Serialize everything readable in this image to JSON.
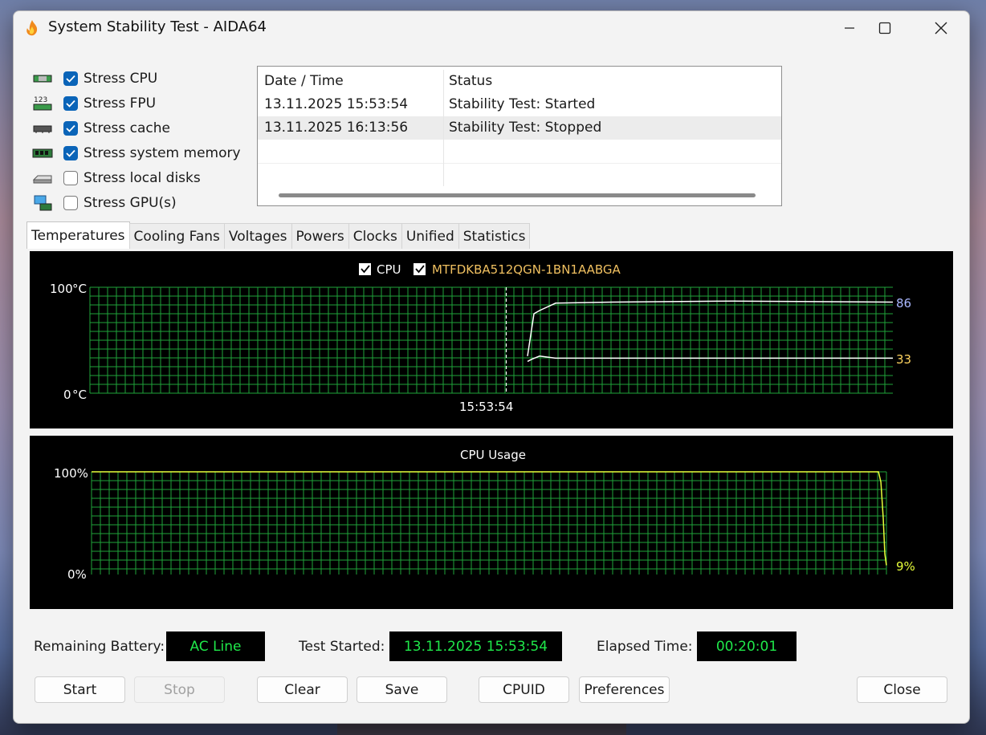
{
  "window": {
    "title": "System Stability Test - AIDA64",
    "controls": {
      "minimize_icon": "minimize-icon",
      "maximize_icon": "maximize-icon",
      "close_icon": "close-icon"
    }
  },
  "stress_options": [
    {
      "label": "Stress CPU",
      "checked": true,
      "icon": "cpu-chip-icon"
    },
    {
      "label": "Stress FPU",
      "checked": true,
      "icon": "fpu-123-icon"
    },
    {
      "label": "Stress cache",
      "checked": true,
      "icon": "cache-chip-icon"
    },
    {
      "label": "Stress system memory",
      "checked": true,
      "icon": "memory-module-icon"
    },
    {
      "label": "Stress local disks",
      "checked": false,
      "icon": "disk-drive-icon"
    },
    {
      "label": "Stress GPU(s)",
      "checked": false,
      "icon": "gpu-monitor-icon"
    }
  ],
  "log": {
    "columns": [
      "Date / Time",
      "Status"
    ],
    "rows": [
      [
        "13.11.2025 15:53:54",
        "Stability Test: Started"
      ],
      [
        "13.11.2025 16:13:56",
        "Stability Test: Stopped"
      ]
    ]
  },
  "tabs": [
    "Temperatures",
    "Cooling Fans",
    "Voltages",
    "Powers",
    "Clocks",
    "Unified",
    "Statistics"
  ],
  "active_tab": "Temperatures",
  "temperature_chart": {
    "legend": [
      {
        "label": "CPU",
        "checked": true,
        "color": "#ffffff"
      },
      {
        "label": "MTFDKBA512QGN-1BN1AABGA",
        "checked": true,
        "color": "#f0c060"
      }
    ],
    "y_top_label": "100",
    "y_bottom_label": "0",
    "unit": "°C",
    "time_label": "15:53:54",
    "current_values": {
      "cpu": "86",
      "disk": "33"
    },
    "colors": {
      "grid": "#1fa33a",
      "cpu_label": "#aab8ff",
      "disk_label": "#ffd460"
    }
  },
  "usage_chart": {
    "title": "CPU Usage",
    "y_top_label": "100%",
    "y_bottom_label": "0%",
    "current_value": "9%",
    "colors": {
      "grid": "#1fa33a",
      "line": "#e8ff3a"
    }
  },
  "chart_data": [
    {
      "type": "line",
      "title": "",
      "ylim": [
        0,
        100
      ],
      "ylabel": "°C",
      "x_marker": "15:53:54",
      "series": [
        {
          "name": "CPU",
          "color": "#ffffff",
          "points": [
            [
              0.545,
              35
            ],
            [
              0.553,
              75
            ],
            [
              0.56,
              78
            ],
            [
              0.58,
              85
            ],
            [
              0.65,
              86
            ],
            [
              0.8,
              87
            ],
            [
              1.0,
              86
            ]
          ]
        },
        {
          "name": "MTFDKBA512QGN-1BN1AABGA",
          "color": "#ffffff",
          "points": [
            [
              0.545,
              30
            ],
            [
              0.55,
              32
            ],
            [
              0.56,
              35
            ],
            [
              0.58,
              33
            ],
            [
              1.0,
              33
            ]
          ]
        }
      ]
    },
    {
      "type": "line",
      "title": "CPU Usage",
      "ylim": [
        0,
        100
      ],
      "series": [
        {
          "name": "CPU Usage",
          "color": "#e8ff3a",
          "points": [
            [
              0.0,
              100
            ],
            [
              0.99,
              100
            ],
            [
              0.993,
              90
            ],
            [
              0.996,
              55
            ],
            [
              0.998,
              20
            ],
            [
              1.0,
              9
            ]
          ]
        }
      ]
    }
  ],
  "status": {
    "remaining_battery_label": "Remaining Battery:",
    "remaining_battery_value": "AC Line",
    "test_started_label": "Test Started:",
    "test_started_value": "13.11.2025 15:53:54",
    "elapsed_label": "Elapsed Time:",
    "elapsed_value": "00:20:01"
  },
  "buttons": {
    "start": "Start",
    "stop": "Stop",
    "clear": "Clear",
    "save": "Save",
    "cpuid": "CPUID",
    "preferences": "Preferences",
    "close": "Close"
  }
}
